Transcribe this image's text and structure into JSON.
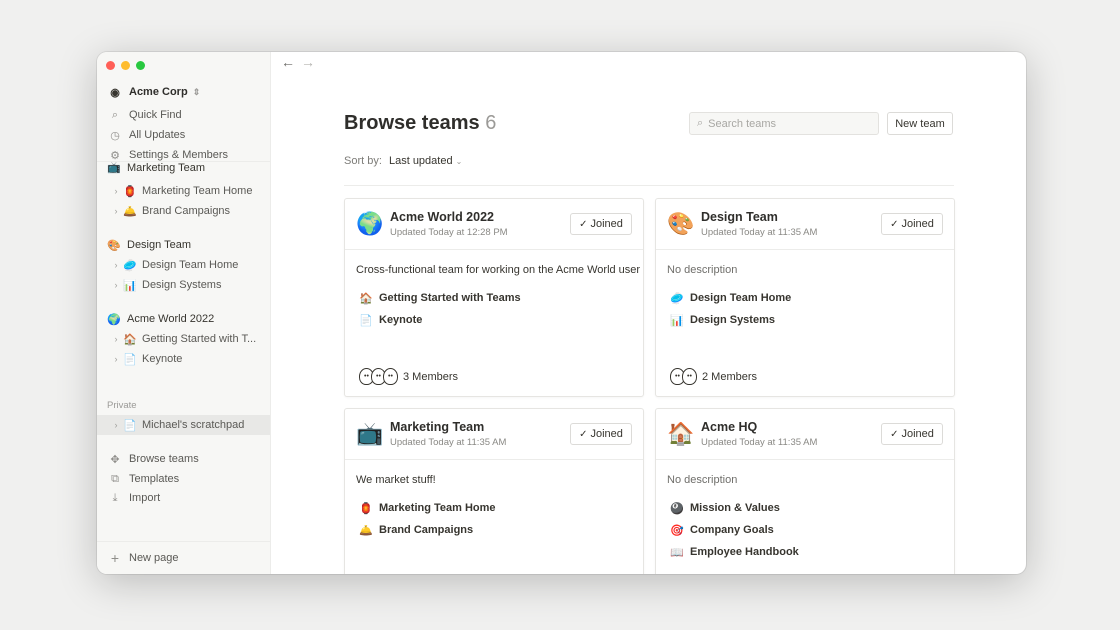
{
  "sidebar": {
    "workspace": "Acme Corp",
    "top_items": [
      {
        "label": "Quick Find",
        "icon": "search-icon"
      },
      {
        "label": "All Updates",
        "icon": "clock-icon"
      },
      {
        "label": "Settings & Members",
        "icon": "gear-icon"
      }
    ],
    "teams": [
      {
        "name": "Marketing Team",
        "emoji": "📺",
        "pages": [
          {
            "label": "Marketing Team Home",
            "emoji": "🏮"
          },
          {
            "label": "Brand Campaigns",
            "emoji": "🛎️"
          }
        ]
      },
      {
        "name": "Design Team",
        "emoji": "🎨",
        "pages": [
          {
            "label": "Design Team Home",
            "emoji": "🥏"
          },
          {
            "label": "Design Systems",
            "emoji": "📊"
          }
        ]
      },
      {
        "name": "Acme World 2022",
        "emoji": "🌍",
        "pages": [
          {
            "label": "Getting Started with T...",
            "emoji": "🏠"
          },
          {
            "label": "Keynote",
            "emoji": "📄"
          }
        ]
      }
    ],
    "private_label": "Private",
    "private_pages": [
      {
        "label": "Michael's scratchpad",
        "emoji": "📄"
      }
    ],
    "bottom_items": [
      {
        "label": "Browse teams",
        "icon": "browse-teams-icon"
      },
      {
        "label": "Templates",
        "icon": "templates-icon"
      },
      {
        "label": "Import",
        "icon": "import-icon"
      }
    ],
    "new_page": "New page"
  },
  "main": {
    "title": "Browse teams",
    "count": "6",
    "search_placeholder": "Search teams",
    "new_team": "New team",
    "sort_label": "Sort by:",
    "sort_value": "Last updated",
    "cards": [
      {
        "name": "Acme World 2022",
        "emoji": "🌍",
        "updated": "Updated Today at 12:28 PM",
        "joined": "Joined",
        "description": "Cross-functional team for working on the Acme World user",
        "pages": [
          {
            "label": "Getting Started with Teams",
            "emoji": "🏠"
          },
          {
            "label": "Keynote",
            "emoji": "📄"
          }
        ],
        "members": "3 Members"
      },
      {
        "name": "Design Team",
        "emoji": "🎨",
        "updated": "Updated Today at 11:35 AM",
        "joined": "Joined",
        "description": "No description",
        "pages": [
          {
            "label": "Design Team Home",
            "emoji": "🥏"
          },
          {
            "label": "Design Systems",
            "emoji": "📊"
          }
        ],
        "members": "2 Members"
      },
      {
        "name": "Marketing Team",
        "emoji": "📺",
        "updated": "Updated Today at 11:35 AM",
        "joined": "Joined",
        "description": "We market stuff!",
        "pages": [
          {
            "label": "Marketing Team Home",
            "emoji": "🏮"
          },
          {
            "label": "Brand Campaigns",
            "emoji": "🛎️"
          }
        ]
      },
      {
        "name": "Acme HQ",
        "emoji": "🏠",
        "updated": "Updated Today at 11:35 AM",
        "joined": "Joined",
        "description": "No description",
        "pages": [
          {
            "label": "Mission & Values",
            "emoji": "🎱"
          },
          {
            "label": "Company Goals",
            "emoji": "🎯"
          },
          {
            "label": "Employee Handbook",
            "emoji": "📖"
          }
        ]
      }
    ]
  },
  "colors": {
    "close": "#ff5f57",
    "minimize": "#febc2e",
    "zoom": "#28c840"
  }
}
